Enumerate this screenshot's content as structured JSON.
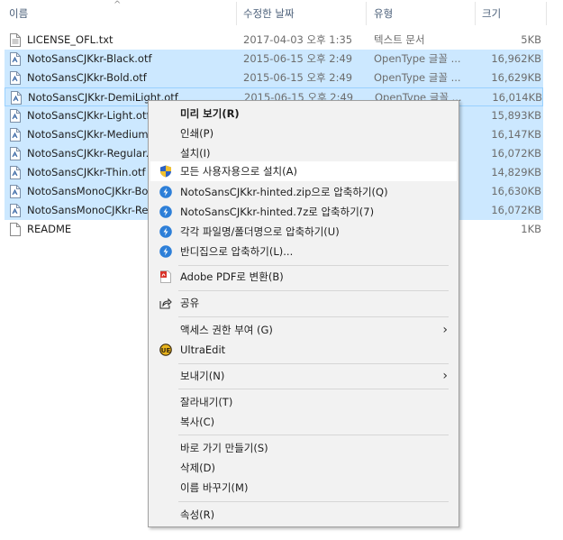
{
  "header": {
    "col_name": "이름",
    "col_date": "수정한 날짜",
    "col_type": "유형",
    "col_size": "크기",
    "sort_glyph": "^"
  },
  "files": [
    {
      "name": "LICENSE_OFL.txt",
      "date": "2017-04-03 오후 1:35",
      "type": "텍스트 문서",
      "size": "5KB",
      "icon": "text-file-icon",
      "selected": false
    },
    {
      "name": "NotoSansCJKkr-Black.otf",
      "date": "2015-06-15 오후 2:49",
      "type": "OpenType 글꼴 ...",
      "size": "16,962KB",
      "icon": "font-file-icon",
      "selected": true
    },
    {
      "name": "NotoSansCJKkr-Bold.otf",
      "date": "2015-06-15 오후 2:49",
      "type": "OpenType 글꼴 ...",
      "size": "16,629KB",
      "icon": "font-file-icon",
      "selected": true
    },
    {
      "name": "NotoSansCJKkr-DemiLight.otf",
      "date": "2015-06-15 오후 2:49",
      "type": "OpenType 글꼴 ...",
      "size": "16,014KB",
      "icon": "font-file-icon",
      "selected": true
    },
    {
      "name": "NotoSansCJKkr-Light.otf",
      "date": "",
      "type": "",
      "size": "15,893KB",
      "icon": "font-file-icon",
      "selected": true
    },
    {
      "name": "NotoSansCJKkr-Medium.",
      "date": "",
      "type": "",
      "size": "16,147KB",
      "icon": "font-file-icon",
      "selected": true
    },
    {
      "name": "NotoSansCJKkr-Regular.c",
      "date": "",
      "type": "",
      "size": "16,072KB",
      "icon": "font-file-icon",
      "selected": true
    },
    {
      "name": "NotoSansCJKkr-Thin.otf",
      "date": "",
      "type": "",
      "size": "14,829KB",
      "icon": "font-file-icon",
      "selected": true
    },
    {
      "name": "NotoSansMonoCJKkr-Bol",
      "date": "",
      "type": "",
      "size": "16,630KB",
      "icon": "font-file-icon",
      "selected": true
    },
    {
      "name": "NotoSansMonoCJKkr-Reg",
      "date": "",
      "type": "",
      "size": "16,072KB",
      "icon": "font-file-icon",
      "selected": true
    },
    {
      "name": "README",
      "date": "",
      "type": "",
      "size": "1KB",
      "icon": "generic-file-icon",
      "selected": false
    }
  ],
  "menu": {
    "preview": "미리 보기(R)",
    "print": "인쇄(P)",
    "install": "설치(I)",
    "install_all_users": "모든 사용자용으로 설치(A)",
    "zip_hinted": "NotoSansCJKkr-hinted.zip으로 압축하기(Q)",
    "sevenz_hinted": "NotoSansCJKkr-hinted.7z로 압축하기(7)",
    "compress_each": "각각 파일명/폴더명으로 압축하기(U)",
    "bandizip": "반디집으로 압축하기(L)...",
    "adobe_pdf": "Adobe PDF로 변환(B)",
    "share": "공유",
    "grant_access": "액세스 권한 부여 (G)",
    "ultraedit": "UltraEdit",
    "send_to": "보내기(N)",
    "cut": "잘라내기(T)",
    "copy": "복사(C)",
    "create_shortcut": "바로 가기 만들기(S)",
    "delete": "삭제(D)",
    "rename": "이름 바꾸기(M)",
    "properties": "속성(R)"
  },
  "colors": {
    "selection": "#cce8ff",
    "selection_border": "#99d1ff",
    "menu_bg": "#f2f2f2",
    "menu_hover": "#ffffff",
    "header_text": "#4c607a",
    "zip_blue": "#2d7fd8"
  }
}
